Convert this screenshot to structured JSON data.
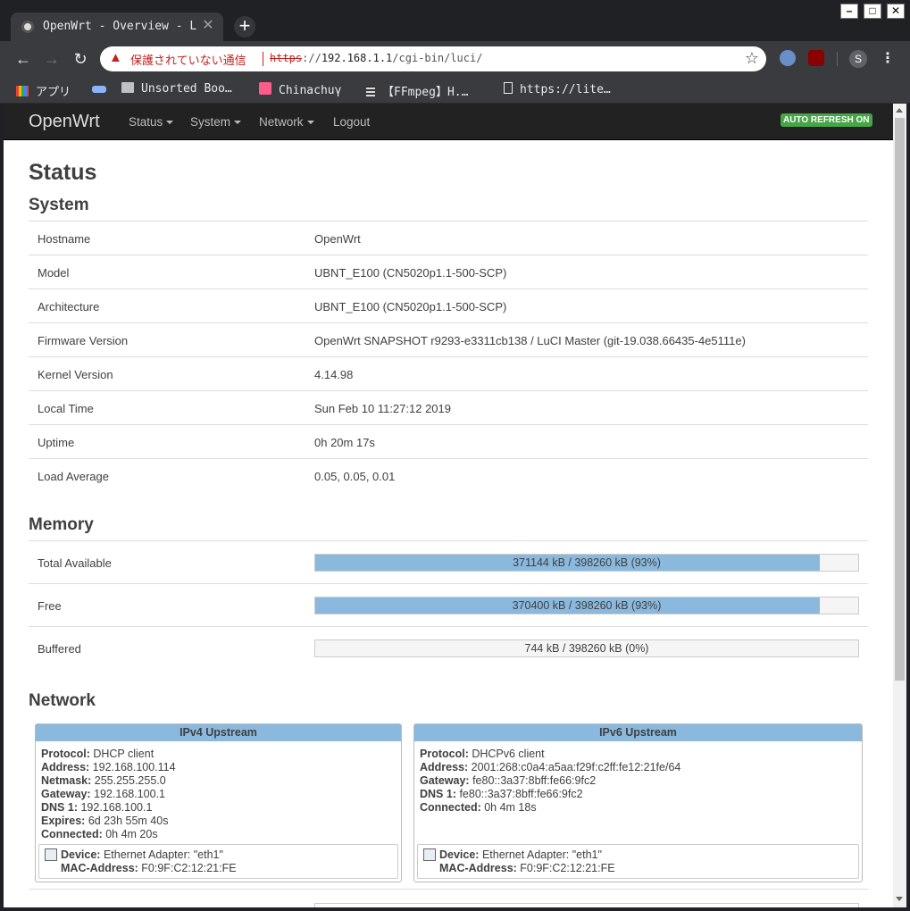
{
  "browser": {
    "tab_title": "OpenWrt - Overview - L",
    "new_tab_symbol": "+",
    "warning_text": "保護されていない通信",
    "url_scheme": "https",
    "url_sep": "://",
    "url_host": "192.168.1.1",
    "url_path": "/cgi-bin/luci/",
    "profile_initial": "S",
    "window_controls": [
      "–",
      "□",
      "✕"
    ]
  },
  "bookmarks": [
    {
      "label": "アプリ",
      "icon": "apps-grid-icon"
    },
    {
      "label": "",
      "icon": "extension-bookmark-icon"
    },
    {
      "label": "Unsorted Boo…",
      "icon": "folder-icon"
    },
    {
      "label": "Chinachuγ",
      "icon": "pink-square-icon"
    },
    {
      "label": "【FFmpeg】H.…",
      "icon": "film-icon"
    },
    {
      "label": "https://lite…",
      "icon": "page-icon"
    }
  ],
  "luci": {
    "brand": "OpenWrt",
    "nav": [
      "Status",
      "System",
      "Network",
      "Logout"
    ],
    "auto_refresh": "AUTO REFRESH ON"
  },
  "page": {
    "title": "Status",
    "system_heading": "System",
    "system_rows": [
      {
        "key": "Hostname",
        "value": "OpenWrt"
      },
      {
        "key": "Model",
        "value": "UBNT_E100 (CN5020p1.1-500-SCP)"
      },
      {
        "key": "Architecture",
        "value": "UBNT_E100 (CN5020p1.1-500-SCP)"
      },
      {
        "key": "Firmware Version",
        "value": "OpenWrt SNAPSHOT r9293-e3311cb138 / LuCI Master (git-19.038.66435-4e5111e)"
      },
      {
        "key": "Kernel Version",
        "value": "4.14.98"
      },
      {
        "key": "Local Time",
        "value": "Sun Feb 10 11:27:12 2019"
      },
      {
        "key": "Uptime",
        "value": "0h 20m 17s"
      },
      {
        "key": "Load Average",
        "value": "0.05, 0.05, 0.01"
      }
    ],
    "memory_heading": "Memory",
    "memory_rows": [
      {
        "key": "Total Available",
        "text": "371144 kB / 398260 kB (93%)",
        "fraction": 0.93
      },
      {
        "key": "Free",
        "text": "370400 kB / 398260 kB (93%)",
        "fraction": 0.93
      },
      {
        "key": "Buffered",
        "text": "744 kB / 398260 kB (0%)",
        "fraction": 0.0
      }
    ],
    "network_heading": "Network",
    "ipv4": {
      "heading": "IPv4 Upstream",
      "lines": [
        {
          "label": "Protocol:",
          "value": " DHCP client"
        },
        {
          "label": "Address:",
          "value": " 192.168.100.114"
        },
        {
          "label": "Netmask:",
          "value": " 255.255.255.0"
        },
        {
          "label": "Gateway:",
          "value": " 192.168.100.1"
        },
        {
          "label": "DNS 1:",
          "value": " 192.168.100.1"
        },
        {
          "label": "Expires:",
          "value": " 6d 23h 55m 40s"
        },
        {
          "label": "Connected:",
          "value": " 0h 4m 20s"
        }
      ],
      "device": {
        "label": "Device:",
        "value": " Ethernet Adapter: \"eth1\""
      },
      "mac": {
        "label": "MAC-Address:",
        "value": " F0:9F:C2:12:21:FE"
      }
    },
    "ipv6": {
      "heading": "IPv6 Upstream",
      "lines": [
        {
          "label": "Protocol:",
          "value": " DHCPv6 client"
        },
        {
          "label": "Address:",
          "value": " 2001:268:c0a4:a5aa:f29f:c2ff:fe12:21fe/64"
        },
        {
          "label": "Gateway:",
          "value": " fe80::3a37:8bff:fe66:9fc2"
        },
        {
          "label": "DNS 1:",
          "value": " fe80::3a37:8bff:fe66:9fc2"
        },
        {
          "label": "Connected:",
          "value": " 0h 4m 18s"
        }
      ],
      "device": {
        "label": "Device:",
        "value": " Ethernet Adapter: \"eth1\""
      },
      "mac": {
        "label": "MAC-Address:",
        "value": " F0:9F:C2:12:21:FE"
      }
    }
  },
  "colors": {
    "progress_fill": "#8ab9dd",
    "badge_green": "#46a546",
    "warning_red": "#c5221f"
  }
}
